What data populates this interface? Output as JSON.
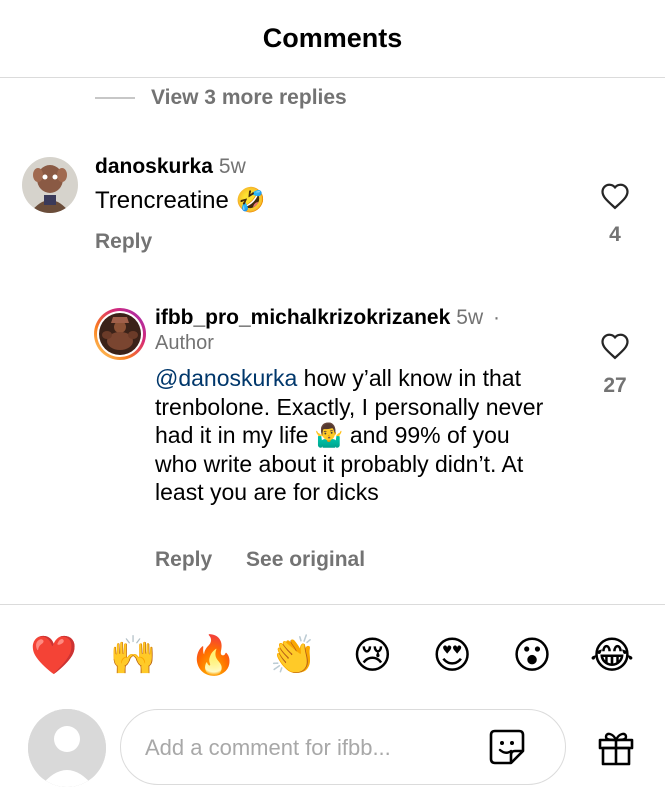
{
  "header": {
    "title": "Comments"
  },
  "thread": {
    "view_more": "View 3 more replies"
  },
  "comment1": {
    "username": "danoskurka",
    "time": "5w",
    "text": "Trencreatine",
    "emoji": "🤣",
    "reply_label": "Reply",
    "likes": "4"
  },
  "comment2": {
    "username": "ifbb_pro_michalkrizokrizanek",
    "time": "5w",
    "separator": "·",
    "role": "Author",
    "mention": "@danoskurka",
    "text_part1": " how y’all know in that trenbolone. Exactly, I personally never had it in my life ",
    "emoji": "🤷‍♂️",
    "text_part2": " and 99% of you who write about it probably didn’t. At least you are for dicks",
    "reply_label": "Reply",
    "see_original_label": "See original",
    "likes": "27"
  },
  "quick_reactions": [
    "❤️",
    "🙌",
    "🔥",
    "👏",
    "😢",
    "😍",
    "😮",
    "😂"
  ],
  "composer": {
    "placeholder": "Add a comment for ifbb..."
  },
  "icons": {
    "heart": "heart-icon",
    "sticker": "sticker-icon",
    "gift": "gift-icon",
    "avatar_placeholder": "default-avatar-icon"
  }
}
